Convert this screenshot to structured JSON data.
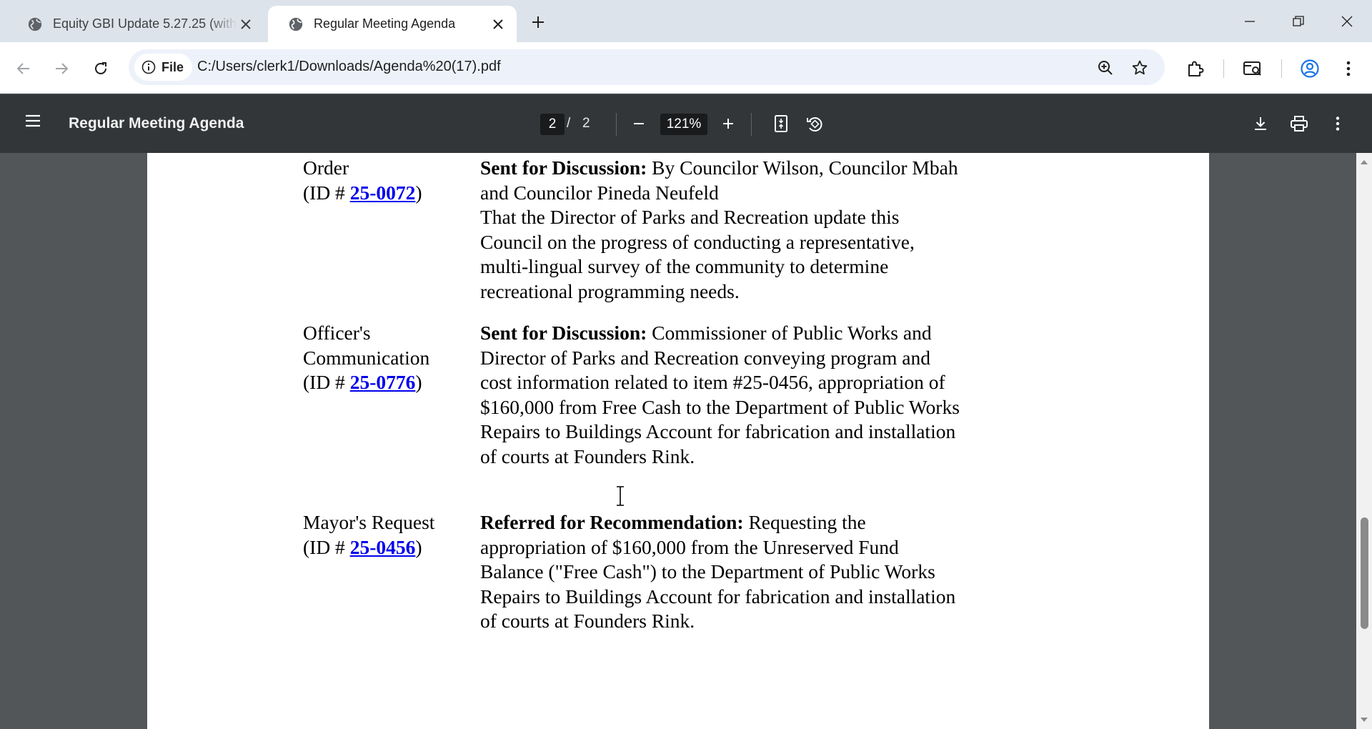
{
  "browser": {
    "tabs": [
      {
        "title": "Equity GBI Update 5.27.25 (with",
        "icon": "globe-icon",
        "active": false
      },
      {
        "title": "Regular Meeting Agenda",
        "icon": "globe-icon",
        "active": true
      }
    ],
    "address": {
      "security_chip": "File",
      "url": "C:/Users/clerk1/Downloads/Agenda%20(17).pdf"
    }
  },
  "pdf_toolbar": {
    "title": "Regular Meeting Agenda",
    "current_page": "2",
    "page_separator": "/",
    "total_pages": "2",
    "zoom": "121%"
  },
  "agenda_items": [
    {
      "type_lines": [
        "Order"
      ],
      "id_prefix": "(ID # ",
      "id": "25-0072",
      "id_suffix": ")",
      "status": "Sent for Discussion:",
      "body": " By Councilor Wilson, Councilor Mbah and Councilor Pineda Neufeld",
      "body2": "That the Director of Parks and Recreation update this Council on the progress of conducting a representative, multi-lingual survey of the community to determine recreational programming needs."
    },
    {
      "type_lines": [
        "Officer's",
        "Communication"
      ],
      "id_prefix": "(ID # ",
      "id": "25-0776",
      "id_suffix": ")",
      "status": "Sent for Discussion:",
      "body": " Commissioner of Public Works and Director of Parks and Recreation conveying program and cost information related to item #25-0456, appropriation of $160,000 from Free Cash to the Department of Public Works Repairs to Buildings Account for fabrication and installation of courts at Founders Rink."
    },
    {
      "type_lines": [
        "Mayor's Request"
      ],
      "id_prefix": "(ID # ",
      "id": "25-0456",
      "id_suffix": ")",
      "status": "Referred for Recommendation:",
      "body": " Requesting the appropriation of $160,000 from the Unreserved Fund Balance (\"Free Cash\") to the Department of Public Works Repairs to Buildings Account for fabrication and installation of courts at Founders Rink."
    }
  ]
}
